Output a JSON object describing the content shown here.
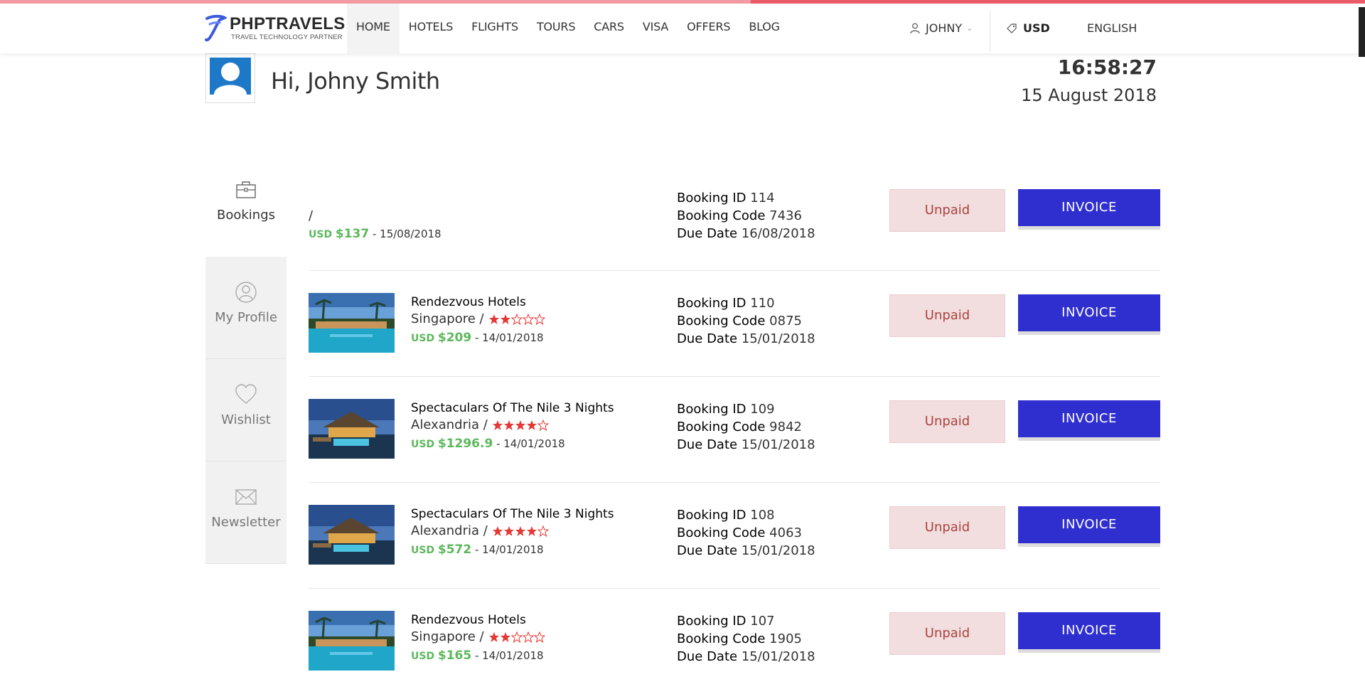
{
  "brand": {
    "name": "PHPTRAVELS",
    "tagline": "TRAVEL TECHNOLOGY PARTNER"
  },
  "nav": [
    "HOME",
    "HOTELS",
    "FLIGHTS",
    "TOURS",
    "CARS",
    "VISA",
    "OFFERS",
    "BLOG"
  ],
  "active_nav": "HOME",
  "user_menu": {
    "label": "JOHNY",
    "icon": "user-icon"
  },
  "currency": {
    "label": "USD",
    "icon": "tag-icon"
  },
  "language": {
    "label": "ENGLISH",
    "icon": "us-flag-icon"
  },
  "greeting": "Hi, Johny Smith",
  "clock": {
    "time": "16:58:27",
    "date": "15 August 2018"
  },
  "sidebar": [
    {
      "label": "Bookings",
      "icon": "briefcase-icon",
      "active": true
    },
    {
      "label": "My Profile",
      "icon": "user-circle-icon",
      "active": false
    },
    {
      "label": "Wishlist",
      "icon": "heart-icon",
      "active": false
    },
    {
      "label": "Newsletter",
      "icon": "envelope-icon",
      "active": false
    }
  ],
  "bookings": [
    {
      "name": "",
      "location": "/",
      "rating": null,
      "currency": "USD",
      "amount": "$137",
      "date": "- 15/08/2018",
      "booking_id": "114",
      "booking_code": "7436",
      "due_date": "16/08/2018",
      "status": "Unpaid",
      "action": "INVOICE",
      "image": null
    },
    {
      "name": "Rendezvous Hotels",
      "location": "Singapore /",
      "rating": 2,
      "currency": "USD",
      "amount": "$209",
      "date": "- 14/01/2018",
      "booking_id": "110",
      "booking_code": "0875",
      "due_date": "15/01/2018",
      "status": "Unpaid",
      "action": "INVOICE",
      "image": "hotel-pool-photo"
    },
    {
      "name": "Spectaculars Of The Nile 3 Nights",
      "location": "Alexandria /",
      "rating": 4,
      "currency": "USD",
      "amount": "$1296.9",
      "date": "- 14/01/2018",
      "booking_id": "109",
      "booking_code": "9842",
      "due_date": "15/01/2018",
      "status": "Unpaid",
      "action": "INVOICE",
      "image": "overwater-villa-photo"
    },
    {
      "name": "Spectaculars Of The Nile 3 Nights",
      "location": "Alexandria /",
      "rating": 4,
      "currency": "USD",
      "amount": "$572",
      "date": "- 14/01/2018",
      "booking_id": "108",
      "booking_code": "4063",
      "due_date": "15/01/2018",
      "status": "Unpaid",
      "action": "INVOICE",
      "image": "overwater-villa-photo"
    },
    {
      "name": "Rendezvous Hotels",
      "location": "Singapore /",
      "rating": 2,
      "currency": "USD",
      "amount": "$165",
      "date": "- 14/01/2018",
      "booking_id": "107",
      "booking_code": "1905",
      "due_date": "15/01/2018",
      "status": "Unpaid",
      "action": "INVOICE",
      "image": "hotel-pool-photo"
    }
  ],
  "labels": {
    "booking_id": "Booking ID",
    "booking_code": "Booking Code",
    "due_date": "Due Date"
  },
  "colors": {
    "accent_blue": "#2f2fd0",
    "price_green": "#5cb85c",
    "unpaid_bg": "#f2dede",
    "unpaid_text": "#a94442",
    "star_red": "#e53935"
  }
}
